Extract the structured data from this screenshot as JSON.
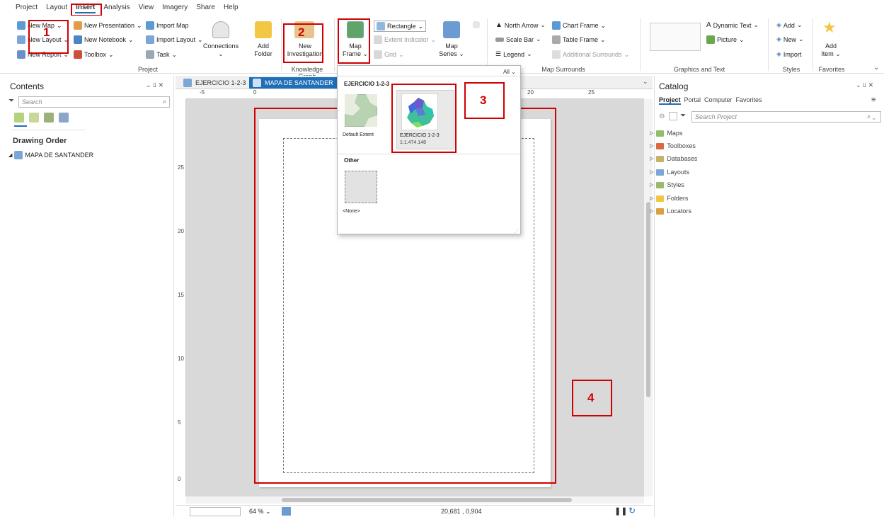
{
  "menu": {
    "items": [
      "Project",
      "Layout",
      "Insert",
      "Analysis",
      "View",
      "Imagery",
      "Share",
      "Help"
    ],
    "active": "Insert"
  },
  "ribbon": {
    "project": {
      "new_map": "New Map",
      "new_layout": "New Layout",
      "new_report": "New Report",
      "new_presentation": "New Presentation",
      "new_notebook": "New Notebook",
      "toolbox": "Toolbox",
      "import_map": "Import Map",
      "import_layout": "Import Layout",
      "task": "Task",
      "connections": "Connections",
      "add_folder_line1": "Add",
      "add_folder_line2": "Folder",
      "group_label": "Project"
    },
    "knowledge_graph": {
      "new_investigation_line1": "New",
      "new_investigation_line2": "Investigation",
      "group_label": "Knowledge Graph"
    },
    "map_frames": {
      "map_frame_line1": "Map",
      "map_frame_line2": "Frame",
      "rectangle": "Rectangle",
      "extent_indicator": "Extent Indicator",
      "grid": "Grid",
      "map_series_line1": "Map",
      "map_series_line2": "Series"
    },
    "map_surrounds": {
      "north_arrow": "North Arrow",
      "scale_bar": "Scale Bar",
      "legend": "Legend",
      "chart_frame": "Chart Frame",
      "table_frame": "Table Frame",
      "additional_surrounds": "Additional Surrounds",
      "group_label": "Map Surrounds"
    },
    "graphics_text": {
      "dynamic_text": "Dynamic Text",
      "picture": "Picture",
      "group_label": "Graphics and Text"
    },
    "styles": {
      "add": "Add",
      "new": "New",
      "import": "Import",
      "group_label": "Styles"
    },
    "favorites": {
      "add_item_line1": "Add",
      "add_item_line2": "Item",
      "group_label": "Favorites"
    }
  },
  "gallery": {
    "filter": "All",
    "section1": "EJERCICIO 1-2-3",
    "item_default": "Default Extent",
    "item_map_name": "EJERCICIO 1-2-3",
    "item_map_scale": "1:1.474.148",
    "section2": "Other",
    "item_none": "<None>"
  },
  "contents": {
    "title": "Contents",
    "search_placeholder": "Search",
    "section": "Drawing Order",
    "layer": "MAPA DE SANTANDER"
  },
  "tabs": {
    "tab1": "EJERCICIO 1-2-3",
    "tab2": "MAPA DE SANTANDER"
  },
  "ruler": {
    "h": [
      "-5",
      "0",
      "20",
      "25"
    ],
    "v": [
      "25",
      "20",
      "15",
      "10",
      "5",
      "0"
    ]
  },
  "status": {
    "zoom": "64 %",
    "coords": "20,681 , 0,904"
  },
  "catalog": {
    "title": "Catalog",
    "tabs": [
      "Project",
      "Portal",
      "Computer",
      "Favorites"
    ],
    "search_placeholder": "Search Project",
    "items": [
      "Maps",
      "Toolboxes",
      "Databases",
      "Layouts",
      "Styles",
      "Folders",
      "Locators"
    ]
  },
  "annotations": [
    "1",
    "2",
    "3",
    "4"
  ],
  "colors": {
    "accent": "#1f6fb8",
    "annotation": "#d00000"
  }
}
